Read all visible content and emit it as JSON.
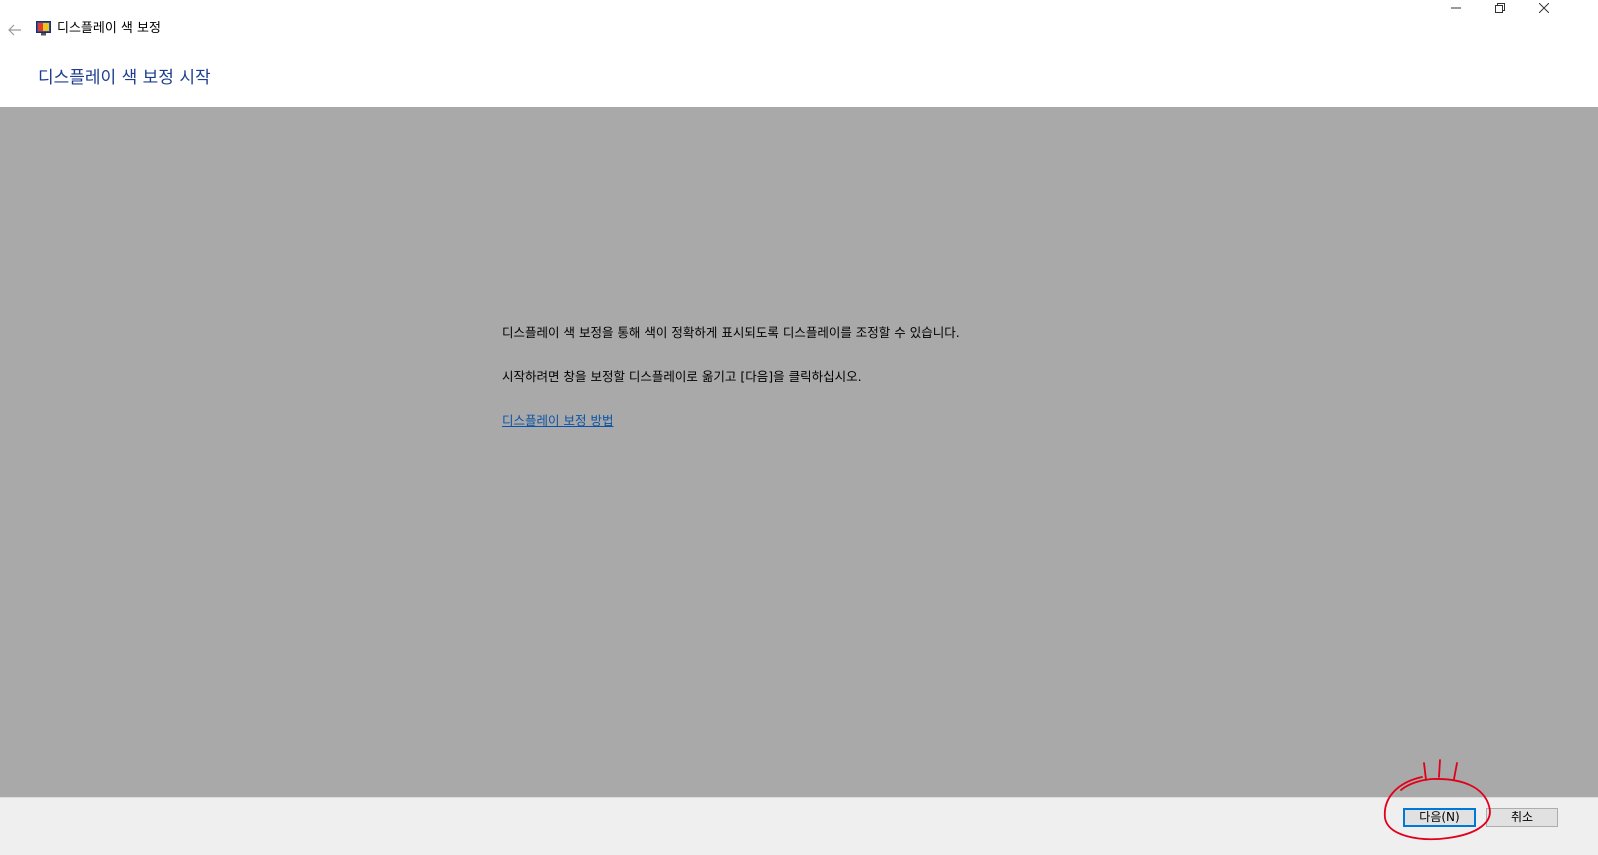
{
  "titlebar": {
    "app_title": "디스플레이 색 보정",
    "back_icon": "back-arrow-icon",
    "app_icon": "display-color-calibration-icon",
    "controls": [
      "minimize-icon",
      "restore-icon",
      "close-icon"
    ]
  },
  "header": {
    "title": "디스플레이 색 보정 시작"
  },
  "main": {
    "line1": "디스플레이 색 보정을 통해 색이 정확하게 표시되도록 디스플레이를 조정할 수 있습니다.",
    "line2": "시작하려면 창을 보정할 디스플레이로 옮기고 [다음]을 클릭하십시오.",
    "help_link": "디스플레이 보정 방법",
    "background_color": "#a9a9a9"
  },
  "footer": {
    "next_label": "다음(N)",
    "cancel_label": "취소"
  },
  "colors": {
    "title_blue": "#1c3d8f",
    "link_blue": "#0b53a6",
    "focus_border": "#0078d7",
    "annotation_red": "#e0001b"
  }
}
